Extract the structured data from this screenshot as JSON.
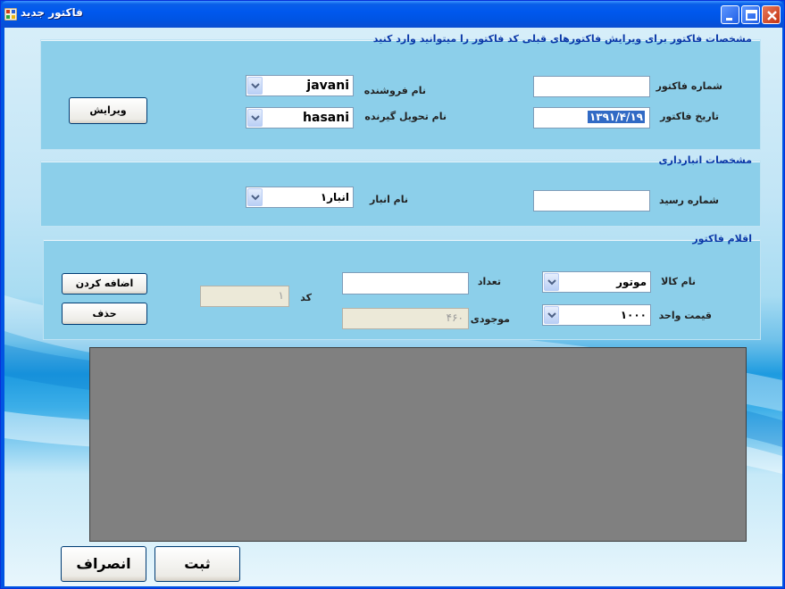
{
  "window": {
    "title": "فاکتور جدید",
    "title_icon": "form-icon",
    "controls": {
      "minimize": "minimize-icon",
      "maximize": "maximize-icon",
      "close": "close-icon"
    }
  },
  "invoice_group": {
    "legend": "مشخصات فاکتور برای ویرایش فاکتورهای قبلی کد فاکتور را میتوانید وارد کنید",
    "invoice_number_label": "شماره فاکتور",
    "invoice_number_value": "",
    "invoice_date_label": "تاریخ فاکتور",
    "invoice_date_value": "۱۳۹۱/۴/۱۹",
    "seller_label": "نام فروشنده",
    "seller_value": "javani",
    "receiver_label": "نام تحویل گیرنده",
    "receiver_value": "hasani",
    "edit_button": "ویرایش"
  },
  "warehouse_group": {
    "legend": "مشخصات انبارداری",
    "receipt_number_label": "شماره رسید",
    "receipt_number_value": "",
    "warehouse_label": "نام انبار",
    "warehouse_value": "انبار۱"
  },
  "items_group": {
    "legend": "اقلام فاکتور",
    "product_label": "نام کالا",
    "product_value": "موتور",
    "unit_price_label": "قیمت واحد",
    "unit_price_value": "۱۰۰۰",
    "quantity_label": "تعداد",
    "quantity_value": "",
    "stock_label": "موجودی",
    "stock_value": "۴۶۰",
    "code_label": "کد",
    "code_value": "۱",
    "add_button": "اضافه کردن",
    "delete_button": "حذف"
  },
  "footer": {
    "save_button": "ثبت",
    "cancel_button": "انصراف"
  },
  "colors": {
    "title_bar": "#0054e3",
    "group_background": "#8ccfea",
    "legend_text": "#0a38a8",
    "grid_background": "#808080",
    "selection": "#316ac5"
  }
}
